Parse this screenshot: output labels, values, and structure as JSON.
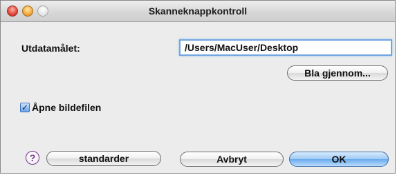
{
  "window": {
    "title": "Skanneknappkontroll"
  },
  "output": {
    "label": "Utdatamålet:",
    "path_value": "/Users/MacUser/Desktop",
    "browse_label": "Bla gjennom..."
  },
  "open_image": {
    "label": "Åpne bildefilen",
    "checked": true
  },
  "footer": {
    "help_symbol": "?",
    "default_label": "standarder",
    "cancel_label": "Avbryt",
    "ok_label": "OK"
  },
  "colors": {
    "accent": "#6aa9ec",
    "help_purple": "#7a2f8f"
  }
}
